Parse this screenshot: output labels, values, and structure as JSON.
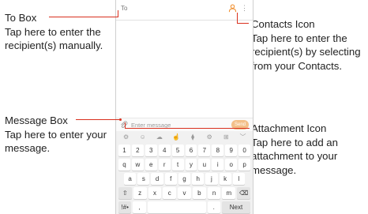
{
  "callouts": {
    "to_box": {
      "title": "To Box",
      "desc": "Tap here to enter the recipient(s) manually."
    },
    "contacts_icon": {
      "title": "Contacts Icon",
      "desc": "Tap here to enter the recipient(s) by selecting from your Contacts."
    },
    "message_box": {
      "title": "Message Box",
      "desc": "Tap here to enter your message."
    },
    "attachment_icon": {
      "title": "Attachment Icon",
      "desc": "Tap here to add an attachment to your message."
    }
  },
  "phone": {
    "to_label": "To",
    "message_placeholder": "Enter message",
    "send_label": "Send",
    "keyboard": {
      "tools": [
        "⚙",
        "☺",
        "☁",
        "☝",
        "⧫",
        "⚙",
        "⊞",
        "﹀"
      ],
      "row_numbers": [
        "1",
        "2",
        "3",
        "4",
        "5",
        "6",
        "7",
        "8",
        "9",
        "0"
      ],
      "row1": [
        "q",
        "w",
        "e",
        "r",
        "t",
        "y",
        "u",
        "i",
        "o",
        "p"
      ],
      "row2": [
        "a",
        "s",
        "d",
        "f",
        "g",
        "h",
        "j",
        "k",
        "l"
      ],
      "row3": [
        "⇧",
        "z",
        "x",
        "c",
        "v",
        "b",
        "n",
        "m",
        "⌫"
      ],
      "row4": [
        "!#•",
        ",",
        "",
        ".",
        "Next"
      ]
    }
  },
  "colors": {
    "callout_line": "#d9301e",
    "accent": "#f08a24"
  }
}
